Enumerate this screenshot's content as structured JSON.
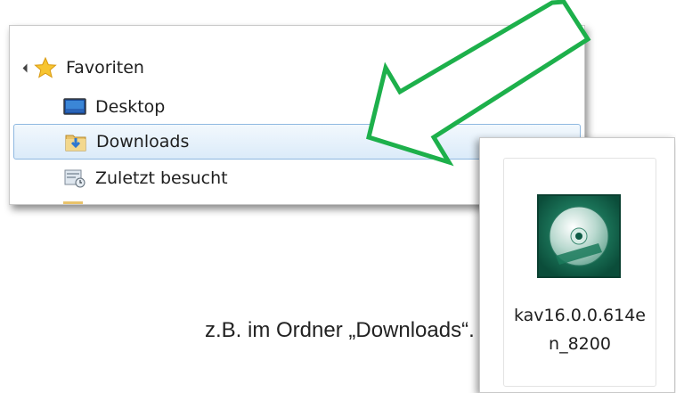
{
  "nav": {
    "items": [
      {
        "label": "Favoriten",
        "icon": "star-icon"
      },
      {
        "label": "Desktop",
        "icon": "desktop-icon"
      },
      {
        "label": "Downloads",
        "icon": "downloads-folder-icon",
        "selected": true
      },
      {
        "label": "Zuletzt besucht",
        "icon": "recent-places-icon"
      }
    ]
  },
  "file": {
    "name": "kav16.0.0.614en_8200",
    "icon": "disc-installer-icon"
  },
  "caption": "z.B. im Ordner „Downloads“.",
  "colors": {
    "arrow": "#1db04b",
    "selection": "#dbebf9",
    "selection_border": "#8fb8e0",
    "disc_box": "#0f6b52"
  }
}
